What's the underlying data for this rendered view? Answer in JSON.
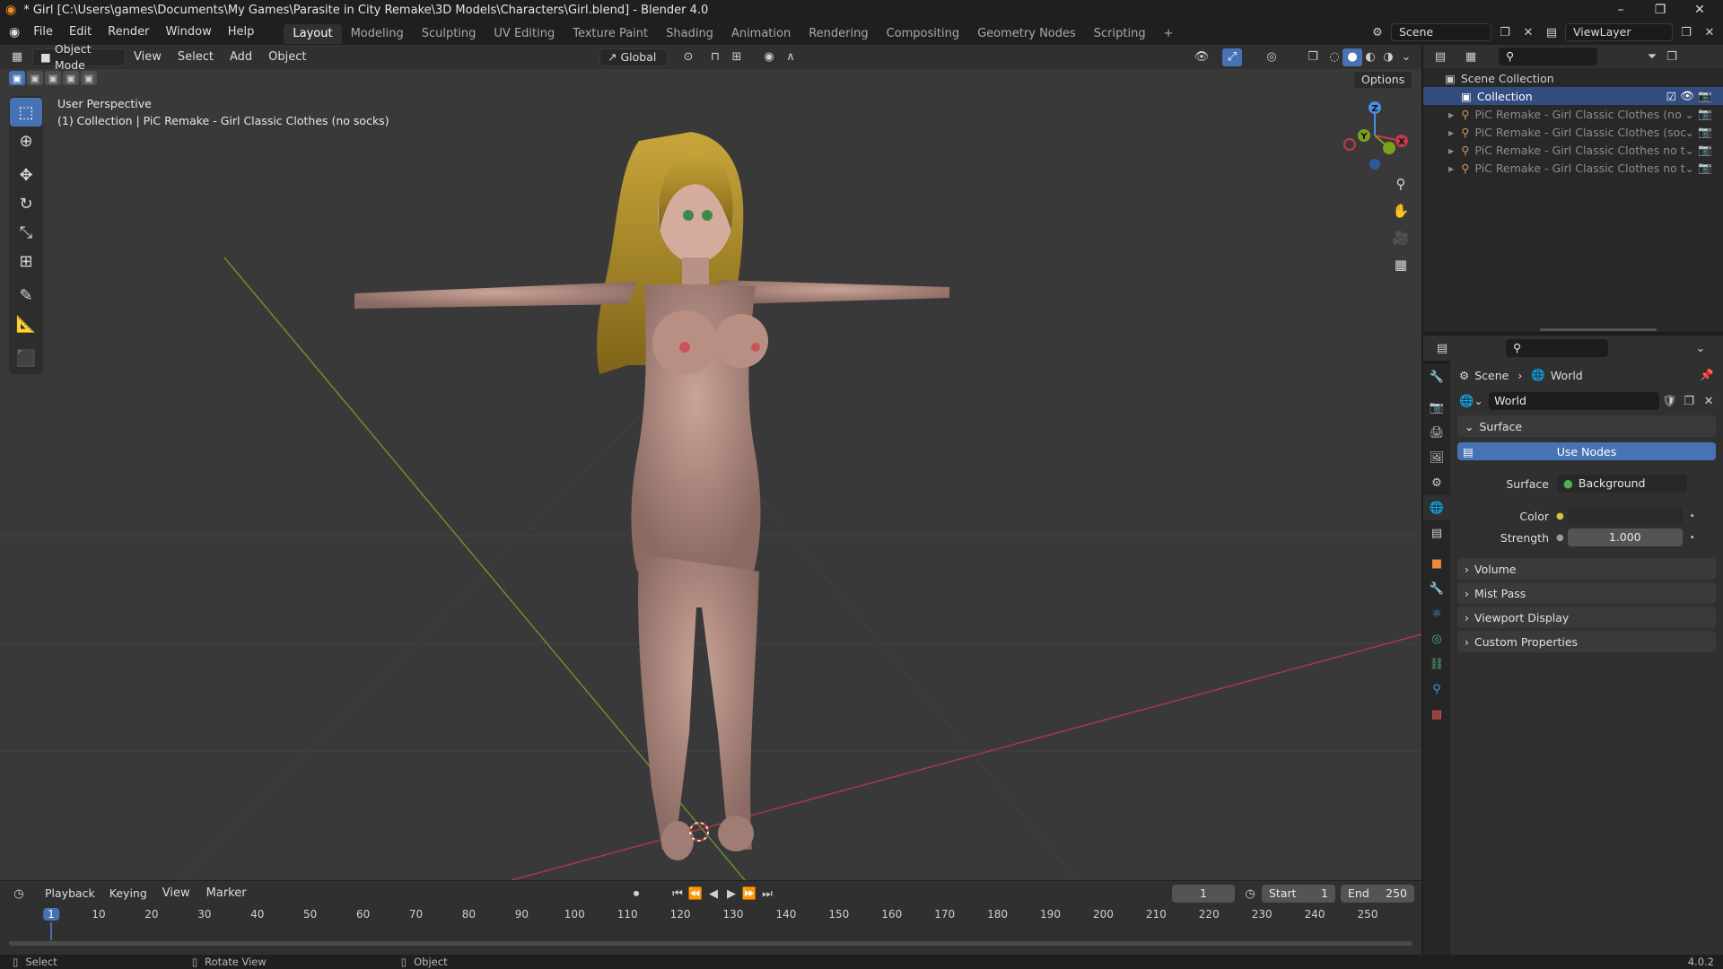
{
  "window": {
    "title": "* Girl [C:\\Users\\games\\Documents\\My Games\\Parasite in City Remake\\3D Models\\Characters\\Girl.blend] - Blender 4.0",
    "minimize": "–",
    "maximize": "❐",
    "close": "✕"
  },
  "menu": [
    "File",
    "Edit",
    "Render",
    "Window",
    "Help"
  ],
  "workspaces": [
    {
      "label": "Layout",
      "active": true
    },
    {
      "label": "Modeling"
    },
    {
      "label": "Sculpting"
    },
    {
      "label": "UV Editing"
    },
    {
      "label": "Texture Paint"
    },
    {
      "label": "Shading"
    },
    {
      "label": "Animation"
    },
    {
      "label": "Rendering"
    },
    {
      "label": "Compositing"
    },
    {
      "label": "Geometry Nodes"
    },
    {
      "label": "Scripting"
    }
  ],
  "add_workspace": "+",
  "scene": {
    "label": "Scene",
    "view_layer": "ViewLayer"
  },
  "viewport_header": {
    "mode": "Object Mode",
    "menus": [
      "View",
      "Select",
      "Add",
      "Object"
    ],
    "orientation": "Global",
    "options": "Options"
  },
  "viewport": {
    "perspective": "User Perspective",
    "collection_info": "(1) Collection | PiC Remake - Girl Classic Clothes (no socks)",
    "gizmo": {
      "z": "Z",
      "y": "Y",
      "x": "X"
    }
  },
  "outliner": {
    "root": "Scene Collection",
    "collection": "Collection",
    "objects": [
      "PiC Remake - Girl Classic Clothes (no",
      "PiC Remake - Girl Classic Clothes (soc",
      "PiC Remake - Girl Classic Clothes no t",
      "PiC Remake - Girl Classic Clothes no t"
    ]
  },
  "properties": {
    "breadcrumb": [
      "Scene",
      "World"
    ],
    "world_name": "World",
    "surface_panel": "Surface",
    "use_nodes": "Use Nodes",
    "surface_label": "Surface",
    "surface_value": "Background",
    "color_label": "Color",
    "strength_label": "Strength",
    "strength_value": "1.000",
    "collapsed_panels": [
      "Volume",
      "Mist Pass",
      "Viewport Display",
      "Custom Properties"
    ]
  },
  "timeline": {
    "menus": [
      "Playback",
      "Keying",
      "View",
      "Marker"
    ],
    "current_frame": "1",
    "start_label": "Start",
    "start": "1",
    "end_label": "End",
    "end": "250",
    "ticks": [
      "1",
      "10",
      "20",
      "30",
      "40",
      "50",
      "60",
      "70",
      "80",
      "90",
      "100",
      "110",
      "120",
      "130",
      "140",
      "150",
      "160",
      "170",
      "180",
      "190",
      "200",
      "210",
      "220",
      "230",
      "240",
      "250"
    ]
  },
  "status": {
    "select": "Select",
    "rotate": "Rotate View",
    "object": "Object",
    "version": "4.0.2"
  },
  "colors": {
    "accent": "#4772b3",
    "viewport_bg": "#393939",
    "x_axis": "#c4394b",
    "y_axis": "#7aa21f",
    "z_axis": "#4a8fe0"
  },
  "icons": [
    "blender-logo-icon",
    "search-icon",
    "filter-icon",
    "eye-icon",
    "camera-icon",
    "zoom-icon",
    "hand-icon",
    "grid-icon"
  ]
}
